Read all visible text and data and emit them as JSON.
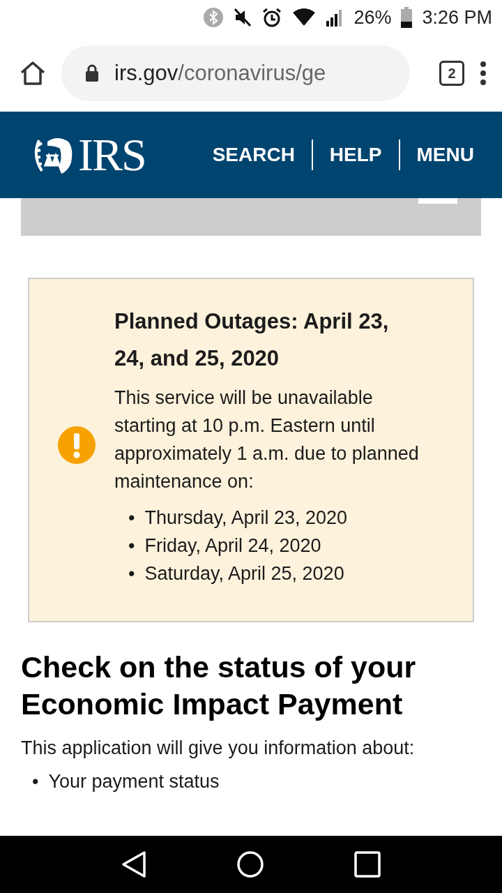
{
  "status_bar": {
    "battery": "26%",
    "time": "3:26 PM"
  },
  "browser": {
    "url_host": "irs.gov",
    "url_path": "/coronavirus/ge",
    "tab_count": "2"
  },
  "header": {
    "logo": "IRS",
    "nav": [
      "SEARCH",
      "HELP",
      "MENU"
    ]
  },
  "alert": {
    "title": "Planned Outages: April 23, 24, and 25, 2020",
    "body": "This service will be unavailable starting at 10 p.m. Eastern until approximately 1 a.m. due to planned maintenance on:",
    "bullet": "•",
    "dates": [
      "Thursday, April 23, 2020",
      "Friday, April 24, 2020",
      "Saturday, April 25, 2020"
    ]
  },
  "content": {
    "heading": "Check on the status of your Economic Impact Payment",
    "intro": "This application will give you information about:",
    "bullet": "•",
    "items": [
      "Your payment status"
    ]
  }
}
